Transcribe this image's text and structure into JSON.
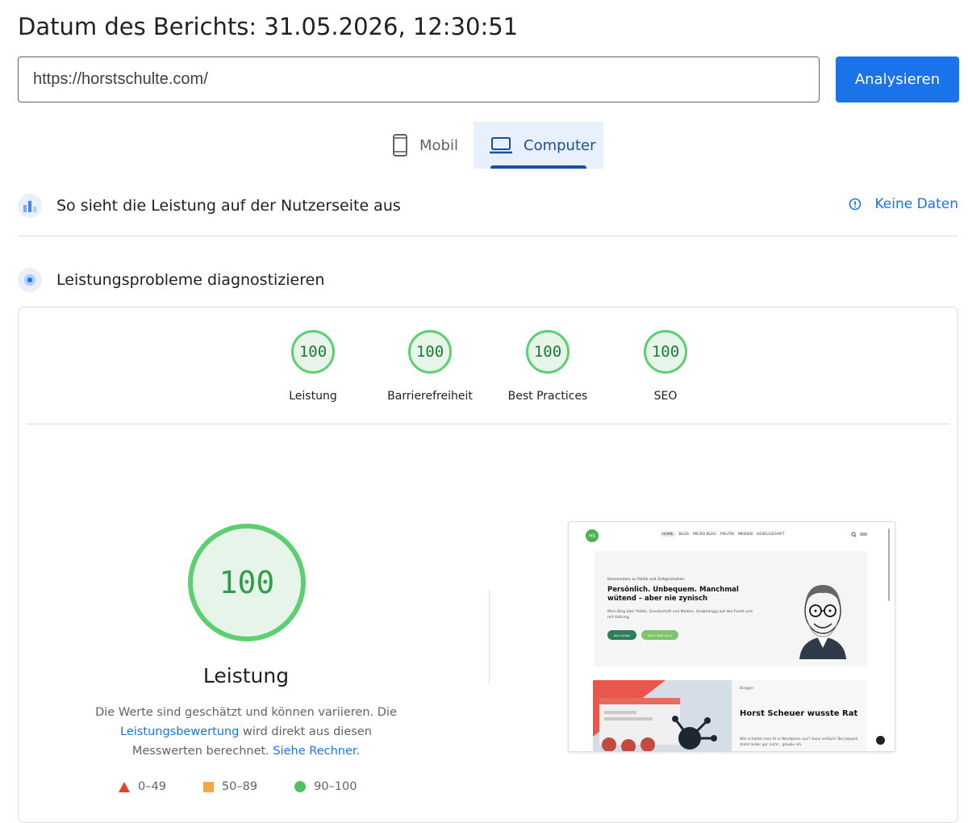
{
  "header": {
    "title": "Datum des Berichts: 31.05.2026, 12:30:51"
  },
  "search": {
    "url_value": "https://horstschulte.com/",
    "button_label": "Analysieren"
  },
  "device_tabs": [
    {
      "label": "Mobil",
      "icon": "smartphone-icon",
      "selected": false
    },
    {
      "label": "Computer",
      "icon": "laptop-icon",
      "selected": true
    }
  ],
  "field_section": {
    "title": "So sieht die Leistung auf der Nutzerseite aus",
    "icon": "field-data-icon",
    "no_data_label": "Keine Daten",
    "no_data_icon": "info-icon"
  },
  "diagnose_section": {
    "title": "Leistungsprobleme diagnostizieren",
    "icon": "lab-data-icon"
  },
  "scores": [
    {
      "label": "Leistung",
      "value": "100"
    },
    {
      "label": "Barrierefreiheit",
      "value": "100"
    },
    {
      "label": "Best Practices",
      "value": "100"
    },
    {
      "label": "SEO",
      "value": "100"
    }
  ],
  "performance": {
    "score": "100",
    "title": "Leistung",
    "desc_part1": "Die Werte sind geschätzt und können variieren. Die ",
    "desc_link1": "Leistungsbewertung",
    "desc_part2": " wird direkt aus diesen Messwerten berechnet. ",
    "desc_link2": "Siehe Rechner",
    "desc_part3": "."
  },
  "legend": [
    {
      "range": "0–49",
      "shape": "triangle",
      "color": "#e2412f"
    },
    {
      "range": "50–89",
      "shape": "square",
      "color": "#f5a742"
    },
    {
      "range": "90–100",
      "shape": "circle",
      "color": "#4dc25f"
    }
  ],
  "preview": {
    "logo_text": "HS",
    "nav": [
      "HOME",
      "BLOG",
      "MICRO BLOG",
      "POLITIK",
      "MEDIEN",
      "GESELLSCHAFT"
    ],
    "kicker": "Kommentare zu Politik und Zeitgeschehen",
    "headline": "Persönlich. Unbequem. Manchmal wütend – aber nie zynisch",
    "text": "Mein Blog über Politik, Gesellschaft und Medien. Unabhängig auf den Punkt und mit Haltung.",
    "button1": "Alle Artikel",
    "button2": "Mehr über mich",
    "card_tag": "Blogger",
    "card_title": "Horst Scheuer wusste Rat",
    "card_excerpt": "Wie schaltet man AI in Wordpress aus? Ganz einfach! Bei Jetpack dreht leider gar nicht – glaube ich."
  },
  "colors": {
    "accent": "#1a73e8",
    "pass_green": "#5ccf6f",
    "pass_bg": "#e6f4ea"
  }
}
